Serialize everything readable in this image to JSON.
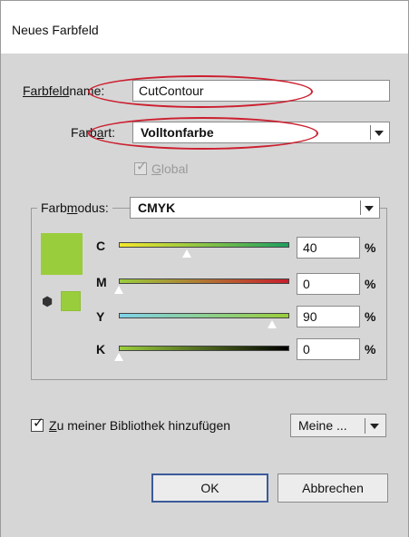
{
  "window": {
    "title": "Neues Farbfeld"
  },
  "form": {
    "name_label_pre": "Farbfeld",
    "name_label_u": "n",
    "name_label_post": "ame:",
    "name_value": "CutContour",
    "type_label_pre": "Farb",
    "type_label_u": "a",
    "type_label_post": "rt:",
    "type_value": "Volltonfarbe",
    "global_label_u": "G",
    "global_label_post": "lobal",
    "global_checked": true,
    "global_enabled": false
  },
  "mode": {
    "label_pre": "Farb",
    "label_u": "m",
    "label_post": "odus:",
    "value": "CMYK"
  },
  "swatch_color": "#9acd3c",
  "sliders": [
    {
      "label": "C",
      "value": "40",
      "unit": "%",
      "fraction": 0.4
    },
    {
      "label": "M",
      "value": "0",
      "unit": "%",
      "fraction": 0.0
    },
    {
      "label": "Y",
      "value": "90",
      "unit": "%",
      "fraction": 0.9
    },
    {
      "label": "K",
      "value": "0",
      "unit": "%",
      "fraction": 0.0
    }
  ],
  "library": {
    "label_u": "Z",
    "label_post": "u meiner Bibliothek hinzufügen",
    "checked": true,
    "select_value": "Meine ..."
  },
  "buttons": {
    "ok": "OK",
    "cancel": "Abbrechen"
  },
  "colors": {
    "annotation": "#cc1f2f",
    "default_button_border": "#3b5b9a",
    "panel_bg": "#d6d6d6"
  }
}
